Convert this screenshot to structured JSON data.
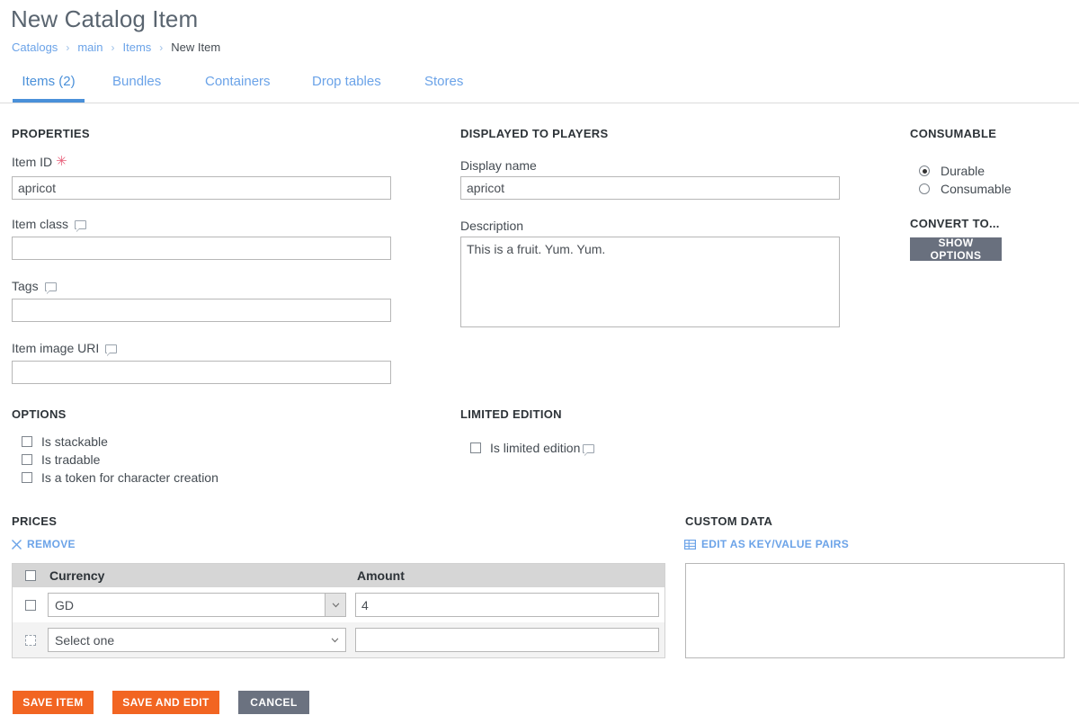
{
  "header": {
    "title": "New Catalog Item",
    "breadcrumb": [
      {
        "label": "Catalogs",
        "current": false
      },
      {
        "label": "main",
        "current": false
      },
      {
        "label": "Items",
        "current": false
      },
      {
        "label": "New Item",
        "current": true
      }
    ],
    "separator": "›"
  },
  "tabs": [
    {
      "label": "Items (2)",
      "active": true
    },
    {
      "label": "Bundles",
      "active": false
    },
    {
      "label": "Containers",
      "active": false
    },
    {
      "label": "Drop tables",
      "active": false
    },
    {
      "label": "Stores",
      "active": false
    }
  ],
  "properties": {
    "heading": "PROPERTIES",
    "item_id": {
      "label": "Item ID",
      "required_marker": "✳",
      "value": "apricot",
      "placeholder": ""
    },
    "item_class": {
      "label": "Item class",
      "value": "",
      "placeholder": "",
      "tooltip_icon": "speech-bubble-icon"
    },
    "tags": {
      "label": "Tags",
      "value": "",
      "placeholder": "",
      "tooltip_icon": "speech-bubble-icon"
    },
    "item_image_uri": {
      "label": "Item image URI",
      "value": "",
      "placeholder": "",
      "tooltip_icon": "speech-bubble-icon"
    }
  },
  "displayed_to_players": {
    "heading": "DISPLAYED TO PLAYERS",
    "display_name": {
      "label": "Display name",
      "value": "apricot",
      "placeholder": ""
    },
    "description": {
      "label": "Description",
      "value": "This is a fruit. Yum. Yum.",
      "placeholder": ""
    }
  },
  "consumable": {
    "heading": "CONSUMABLE",
    "options": [
      {
        "label": "Durable",
        "selected": true
      },
      {
        "label": "Consumable",
        "selected": false
      }
    ]
  },
  "convert_to": {
    "heading": "CONVERT TO...",
    "button_label": "SHOW OPTIONS"
  },
  "options": {
    "heading": "OPTIONS",
    "items": [
      {
        "label": "Is stackable",
        "checked": false
      },
      {
        "label": "Is tradable",
        "checked": false
      },
      {
        "label": "Is a token for character creation",
        "checked": false
      }
    ]
  },
  "limited_edition": {
    "heading": "LIMITED EDITION",
    "checkbox": {
      "label": "Is limited edition",
      "checked": false,
      "tooltip_icon": "speech-bubble-icon"
    }
  },
  "prices": {
    "heading": "PRICES",
    "remove_link": "REMOVE",
    "columns": [
      "Currency",
      "Amount"
    ],
    "rows": [
      {
        "currency": "GD",
        "amount": "4",
        "checked": false,
        "disabled": false
      },
      {
        "currency": "Select one",
        "amount": "",
        "checked": false,
        "disabled": true
      }
    ]
  },
  "custom_data": {
    "heading": "CUSTOM DATA",
    "edit_link": "EDIT AS KEY/VALUE PAIRS",
    "value": "",
    "placeholder": ""
  },
  "footer": {
    "save_item": "SAVE ITEM",
    "save_and_edit": "SAVE AND EDIT",
    "cancel": "CANCEL"
  },
  "colors": {
    "accent_blue": "#4a90d9",
    "link_blue": "#6ba3e8",
    "orange": "#f26522",
    "slate": "#69707e",
    "required_pink": "#e8607a"
  }
}
